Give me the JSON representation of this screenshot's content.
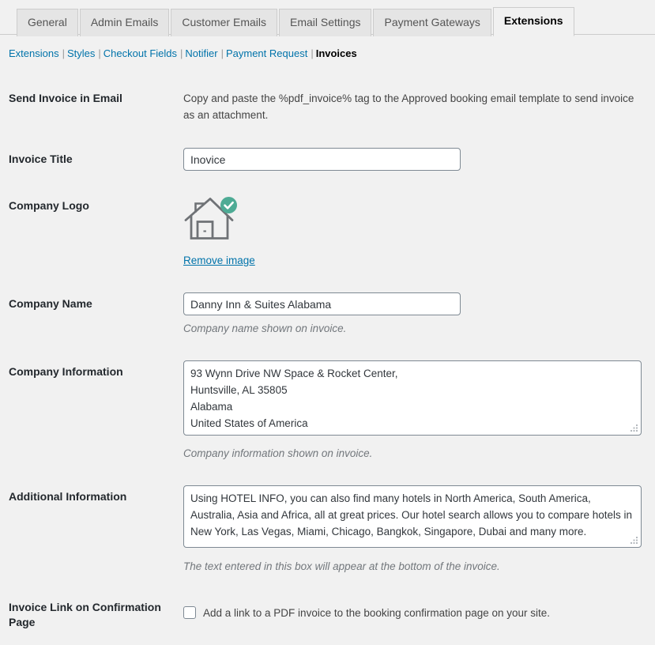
{
  "tabs": [
    {
      "label": "General",
      "active": false
    },
    {
      "label": "Admin Emails",
      "active": false
    },
    {
      "label": "Customer Emails",
      "active": false
    },
    {
      "label": "Email Settings",
      "active": false
    },
    {
      "label": "Payment Gateways",
      "active": false
    },
    {
      "label": "Extensions",
      "active": true
    }
  ],
  "subnav": {
    "items": [
      {
        "label": "Extensions",
        "current": false
      },
      {
        "label": "Styles",
        "current": false
      },
      {
        "label": "Checkout Fields",
        "current": false
      },
      {
        "label": "Notifier",
        "current": false
      },
      {
        "label": "Payment Request",
        "current": false
      },
      {
        "label": "Invoices",
        "current": true
      }
    ],
    "separator": "|"
  },
  "rows": {
    "send_invoice": {
      "label": "Send Invoice in Email",
      "description": "Copy and paste the %pdf_invoice% tag to the Approved booking email template to send invoice as an attachment."
    },
    "invoice_title": {
      "label": "Invoice Title",
      "value": "Inovice",
      "placeholder": ""
    },
    "company_logo": {
      "label": "Company Logo",
      "remove_label": "Remove image",
      "icon": "home-icon",
      "badge_icon": "check-badge-icon"
    },
    "company_name": {
      "label": "Company Name",
      "value": "Danny Inn & Suites Alabama",
      "placeholder": "",
      "description": "Company name shown on invoice."
    },
    "company_information": {
      "label": "Company Information",
      "value": "93 Wynn Drive NW Space & Rocket Center,\nHuntsville, AL 35805\nAlabama\nUnited States of America",
      "placeholder": "",
      "description": "Company information shown on invoice."
    },
    "additional_information": {
      "label": "Additional Information",
      "value": "Using HOTEL INFO, you can also find many hotels in North America, South America, Australia, Asia and Africa, all at great prices. Our hotel search allows you to compare hotels in New York, Las Vegas, Miami, Chicago, Bangkok, Singapore, Dubai and many more.",
      "placeholder": "",
      "description": "The text entered in this box will appear at the bottom of the invoice."
    },
    "invoice_link": {
      "label": "Invoice Link on Confirmation Page",
      "checkbox_label": "Add a link to a PDF invoice to the booking confirmation page on your site.",
      "checked": false
    }
  },
  "colors": {
    "page_background": "#f1f1f1",
    "link": "#0073aa",
    "tab_inactive_background": "#e5e5e5",
    "badge_green": "#4eab95",
    "icon_gray": "#6f7276",
    "label_text": "#23282d",
    "description_text": "#72777c"
  }
}
